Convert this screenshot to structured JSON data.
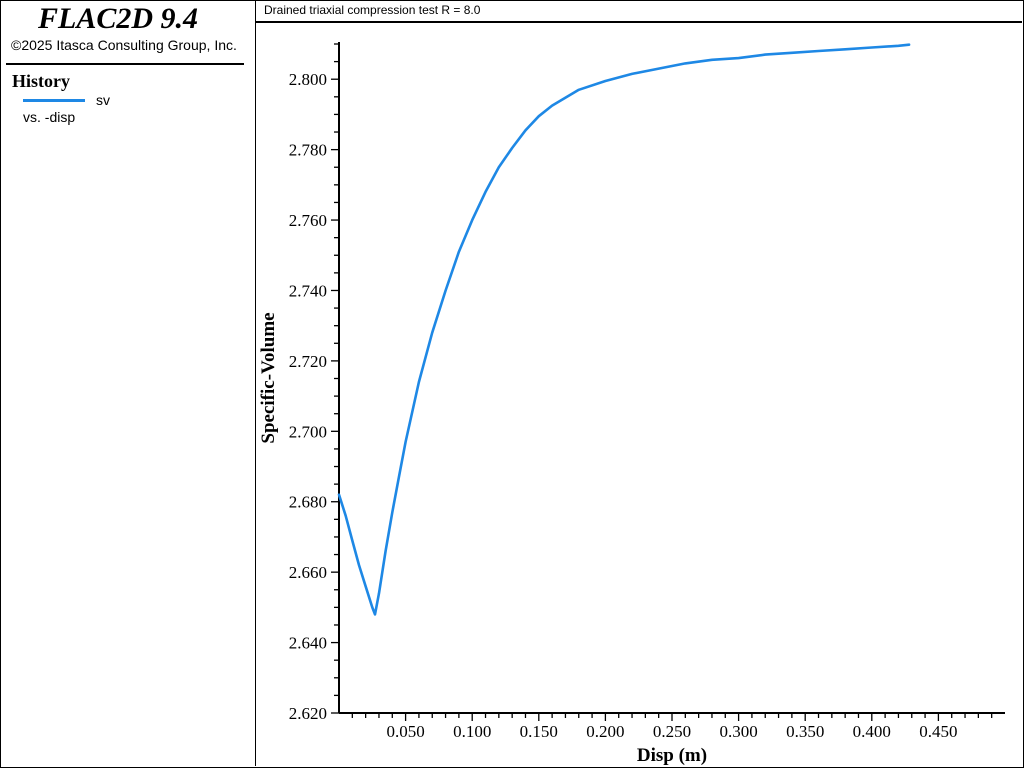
{
  "app": {
    "title": "FLAC2D 9.4",
    "copyright": "©2025 Itasca Consulting Group, Inc."
  },
  "legend": {
    "heading": "History",
    "entries": [
      {
        "label": "sv",
        "sub": "vs. -disp",
        "color": "#1e88e5"
      }
    ]
  },
  "chart_data": {
    "type": "line",
    "title": "Drained triaxial compression test R = 8.0",
    "xlabel": "Disp (m)",
    "ylabel": "Specific-Volume",
    "xlim": [
      0,
      0.5
    ],
    "ylim": [
      2.62,
      2.81
    ],
    "xticks": [
      "0.050",
      "0.100",
      "0.150",
      "0.200",
      "0.250",
      "0.300",
      "0.350",
      "0.400",
      "0.450"
    ],
    "yticks": [
      "2.620",
      "2.640",
      "2.660",
      "2.680",
      "2.700",
      "2.720",
      "2.740",
      "2.760",
      "2.780",
      "2.800"
    ],
    "grid": false,
    "series": [
      {
        "name": "sv",
        "color": "#1e88e5",
        "x": [
          0.0,
          0.005,
          0.01,
          0.015,
          0.02,
          0.025,
          0.027,
          0.03,
          0.035,
          0.04,
          0.045,
          0.05,
          0.06,
          0.07,
          0.08,
          0.09,
          0.1,
          0.11,
          0.12,
          0.13,
          0.14,
          0.15,
          0.16,
          0.18,
          0.2,
          0.22,
          0.24,
          0.26,
          0.28,
          0.3,
          0.32,
          0.34,
          0.36,
          0.38,
          0.4,
          0.42,
          0.428
        ],
        "y": [
          2.682,
          2.676,
          2.669,
          2.662,
          2.656,
          2.65,
          2.648,
          2.654,
          2.666,
          2.677,
          2.687,
          2.697,
          2.714,
          2.728,
          2.74,
          2.751,
          2.76,
          2.768,
          2.775,
          2.7805,
          2.7855,
          2.7895,
          2.7925,
          2.797,
          2.7995,
          2.8015,
          2.803,
          2.8045,
          2.8055,
          2.806,
          2.807,
          2.8075,
          2.808,
          2.8085,
          2.809,
          2.8095,
          2.8098
        ]
      }
    ]
  }
}
